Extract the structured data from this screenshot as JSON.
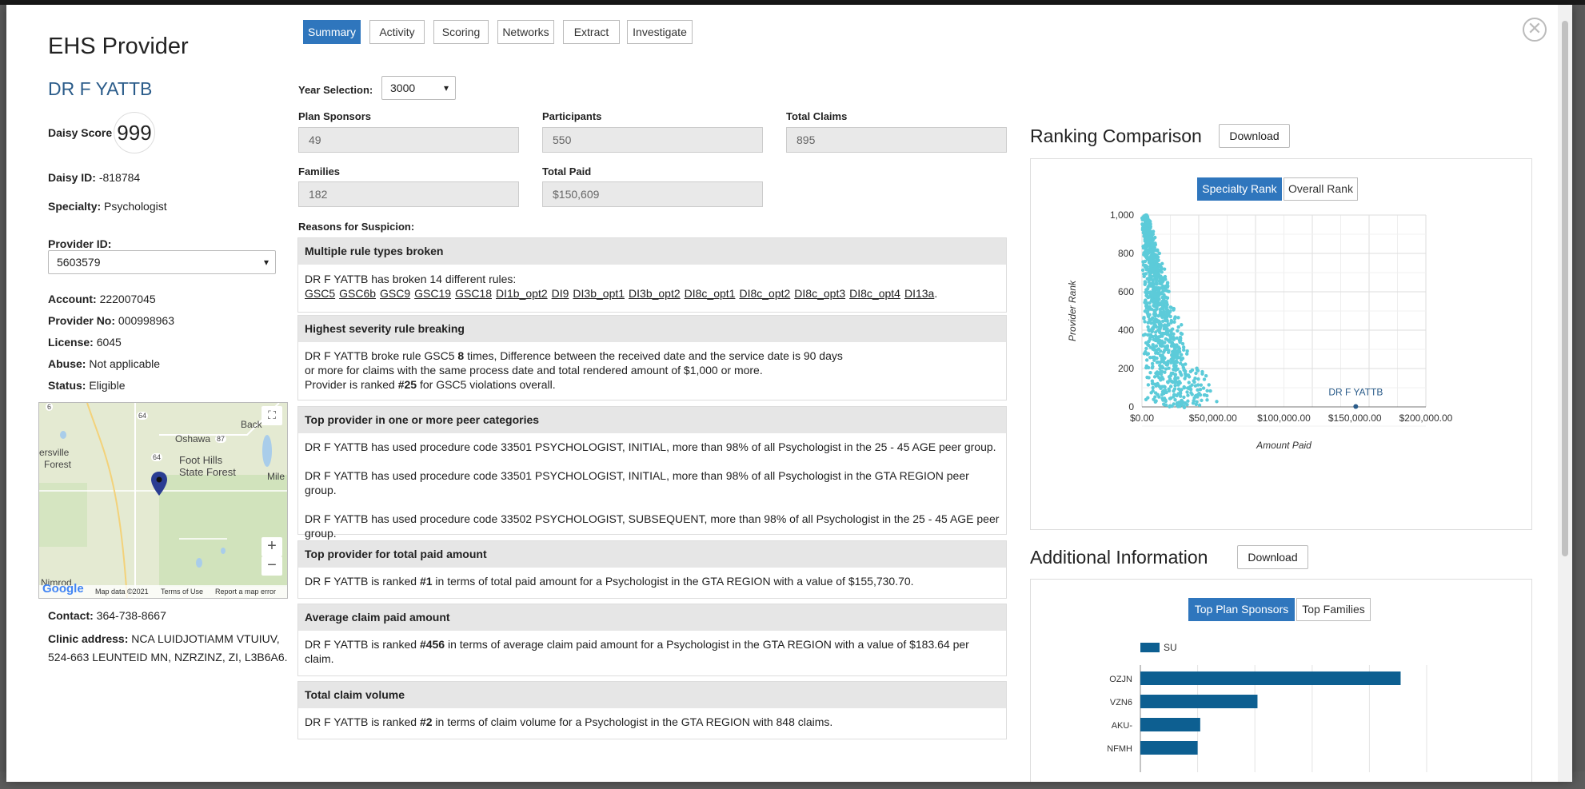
{
  "modal": {
    "title": "EHS Provider",
    "close_glyph": "✕"
  },
  "provider": {
    "name": "DR F YATTB",
    "daisy_score_label": "Daisy Score",
    "daisy_score": "999",
    "daisy_id_label": "Daisy ID:",
    "daisy_id": "-818784",
    "specialty_label": "Specialty:",
    "specialty": "Psychologist",
    "provider_id_label": "Provider ID:",
    "provider_id": "5603579",
    "account_label": "Account:",
    "account": "222007045",
    "provider_no_label": "Provider No:",
    "provider_no": "000998963",
    "license_label": "License:",
    "license": "6045",
    "abuse_label": "Abuse:",
    "abuse": "Not applicable",
    "status_label": "Status:",
    "status": "Eligible",
    "contact_label": "Contact:",
    "contact": "364-738-8667",
    "clinic_label": "Clinic address:",
    "clinic_address": "NCA LUIDJOTIAMM VTUIUV, 524-663 LEUNTEID MN, NZRZINZ, ZI, L3B6A6."
  },
  "map": {
    "labels": [
      "Oshawa",
      "Foot Hills",
      "State Forest",
      "ersville",
      "Forest",
      "Back",
      "Mile",
      "Nimrod",
      "64",
      "87",
      "64",
      "6"
    ],
    "zoom_in": "+",
    "zoom_out": "−",
    "fullscreen_glyph": "⛶",
    "google_logo": "Google",
    "map_data": "Map data ©2021",
    "terms": "Terms of Use",
    "report": "Report a map error"
  },
  "tabs": [
    "Summary",
    "Activity",
    "Scoring",
    "Networks",
    "Extract",
    "Investigate"
  ],
  "year_selection": {
    "label": "Year Selection:",
    "value": "3000"
  },
  "fields": {
    "plan_sponsors_label": "Plan Sponsors",
    "plan_sponsors": "49",
    "participants_label": "Participants",
    "participants": "550",
    "total_claims_label": "Total Claims",
    "total_claims": "895",
    "families_label": "Families",
    "families": "182",
    "total_paid_label": "Total Paid",
    "total_paid": "$150,609"
  },
  "reasons_label": "Reasons for Suspicion:",
  "sections": {
    "multiple": {
      "header": "Multiple rule types broken",
      "text": "DR F YATTB has broken 14 different rules:",
      "rules": [
        "GSC5",
        "GSC6b",
        "GSC9",
        "GSC19",
        "GSC18",
        "DI1b_opt2",
        "DI9",
        "DI3b_opt1",
        "DI3b_opt2",
        "DI8c_opt1",
        "DI8c_opt2",
        "DI8c_opt3",
        "DI8c_opt4",
        "DI13a"
      ],
      "end": "."
    },
    "severity": {
      "header": "Highest severity rule breaking",
      "line1_a": "DR F YATTB broke rule GSC5 ",
      "line1_b": "8",
      "line1_c": " times, Difference between the received date and the service date is 90 days",
      "line2": "or more for claims with the same process date and total rendered amount of $1,000 or more.",
      "line3_a": "Provider is ranked ",
      "line3_b": "#25",
      "line3_c": " for GSC5 violations overall."
    },
    "peer": {
      "header": "Top provider in one or more peer categories",
      "p1": "DR F YATTB has used procedure code 33501 PSYCHOLOGIST, INITIAL, more than 98% of all Psychologist in the 25 - 45 AGE peer group.",
      "p2": "DR F YATTB has used procedure code 33501 PSYCHOLOGIST, INITIAL, more than 98% of all Psychologist in the GTA REGION peer group.",
      "p3": "DR F YATTB has used procedure code 33502 PSYCHOLOGIST, SUBSEQUENT, more than 98% of all Psychologist in the 25 - 45 AGE peer group."
    },
    "total_paid": {
      "header": "Top provider for total paid amount",
      "a": "DR F YATTB is ranked ",
      "b": "#1",
      "c": " in terms of total paid amount for a Psychologist in the GTA REGION with a value of $155,730.70."
    },
    "avg_claim": {
      "header": "Average claim paid amount",
      "a": "DR F YATTB is ranked ",
      "b": "#456",
      "c": " in terms of average claim paid amount for a Psychologist in the GTA REGION with a value of $183.64 per claim."
    },
    "volume": {
      "header": "Total claim volume",
      "a": "DR F YATTB is ranked ",
      "b": "#2",
      "c": " in terms of claim volume for a Psychologist in the GTA REGION with 848 claims."
    }
  },
  "ranking": {
    "title": "Ranking Comparison",
    "download": "Download",
    "seg_specialty": "Specialty Rank",
    "seg_overall": "Overall Rank"
  },
  "additional": {
    "title": "Additional Information",
    "download": "Download",
    "seg_sponsors": "Top Plan Sponsors",
    "seg_families": "Top Families"
  },
  "colors": {
    "primary": "#2f76bd",
    "scatter": "#5ccbd9",
    "bar": "#0d5f91",
    "marker": "#2b5c8a"
  },
  "chart_data": [
    {
      "type": "scatter",
      "xlabel": "Amount Paid",
      "ylabel": "Provider Rank",
      "x_ticks": [
        "$0.00",
        "$50,000.00",
        "$100,000.00",
        "$150,000.00",
        "$200,000.00"
      ],
      "y_ticks": [
        "0",
        "200",
        "400",
        "600",
        "800",
        "1,000"
      ],
      "xlim": [
        0,
        200000
      ],
      "ylim": [
        0,
        1000
      ],
      "highlight": {
        "label": "DR F YATTB",
        "x": 150609,
        "y": 2
      },
      "cloud_points": 1000
    },
    {
      "type": "bar",
      "orientation": "horizontal",
      "legend": "SU",
      "categories": [
        "OZJN",
        "VZN6",
        "AKU-",
        "NFMH"
      ],
      "values": [
        100,
        45,
        23,
        22
      ],
      "xlim": [
        0,
        110
      ]
    }
  ]
}
